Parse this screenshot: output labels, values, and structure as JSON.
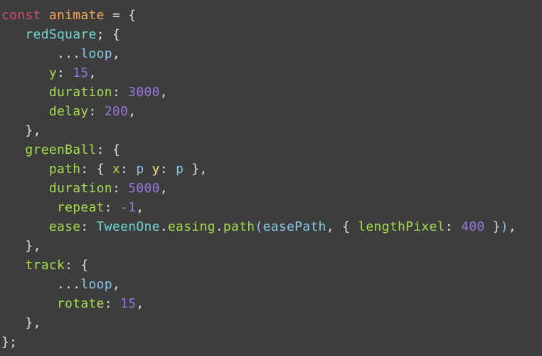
{
  "code": {
    "kw_const": "const",
    "var_animate": "animate",
    "eq": "=",
    "lbrace": "{",
    "rbrace": "}",
    "lparen": "(",
    "rparen": ")",
    "comma": ",",
    "semi": ";",
    "colon": ":",
    "spread": "...",
    "redSquare": "redSquare",
    "loop": "loop",
    "y": "y",
    "num_15": "15",
    "duration": "duration",
    "num_3000": "3000",
    "delay": "delay",
    "num_200": "200",
    "greenBall": "greenBall",
    "path": "path",
    "x": "x",
    "p": "p",
    "num_5000": "5000",
    "repeat": "repeat",
    "neg1": "-1",
    "ease": "ease",
    "TweenOne": "TweenOne",
    "easing": "easing",
    "easePath": "easePath",
    "lengthPixel": "lengthPixel",
    "num_400": "400",
    "track": "track",
    "rotate": "rotate"
  }
}
